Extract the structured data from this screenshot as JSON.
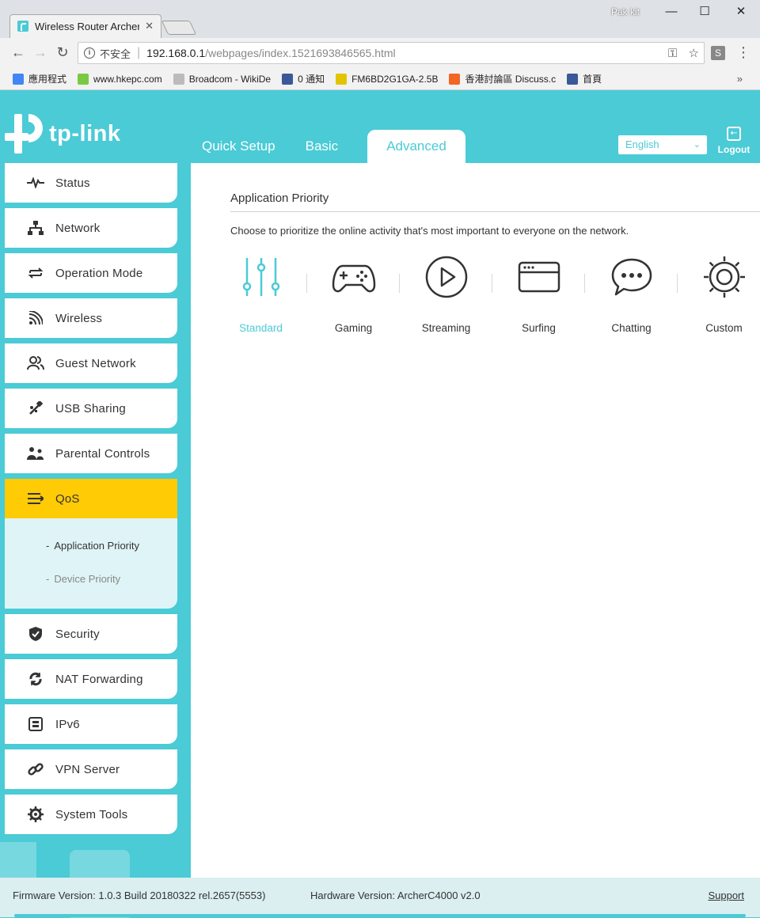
{
  "browser": {
    "tab_title": "Wireless Router Archer C",
    "user": "Pak kit",
    "insecure_label": "不安全",
    "url_host": "192.168.0.1",
    "url_path": "/webpages/index.1521693846565.html",
    "bookmarks": [
      {
        "label": "應用程式",
        "color": "#4285f4"
      },
      {
        "label": "www.hkepc.com",
        "color": "#7ac943"
      },
      {
        "label": "Broadcom - WikiDe",
        "color": "#bbbbbb"
      },
      {
        "label": "0 通知",
        "color": "#3b5998"
      },
      {
        "label": "FM6BD2G1GA-2.5B",
        "color": "#e2c400"
      },
      {
        "label": "香港討論區 Discuss.c",
        "color": "#f26522"
      },
      {
        "label": "首頁",
        "color": "#3b5998"
      }
    ],
    "bookmarks_more": "»"
  },
  "header": {
    "logo_text": "tp-link",
    "tabs": [
      {
        "label": "Quick Setup"
      },
      {
        "label": "Basic"
      },
      {
        "label": "Advanced"
      }
    ],
    "language": "English",
    "logout": "Logout"
  },
  "sidebar": {
    "items": [
      {
        "label": "Status",
        "icon": "pulse-icon"
      },
      {
        "label": "Network",
        "icon": "network-icon"
      },
      {
        "label": "Operation Mode",
        "icon": "swap-icon"
      },
      {
        "label": "Wireless",
        "icon": "wifi-icon"
      },
      {
        "label": "Guest Network",
        "icon": "users-icon"
      },
      {
        "label": "USB Sharing",
        "icon": "usb-icon"
      },
      {
        "label": "Parental Controls",
        "icon": "family-icon"
      },
      {
        "label": "QoS",
        "icon": "qos-icon"
      },
      {
        "label": "Security",
        "icon": "shield-icon"
      },
      {
        "label": "NAT Forwarding",
        "icon": "nat-icon"
      },
      {
        "label": "IPv6",
        "icon": "ipv6-icon"
      },
      {
        "label": "VPN Server",
        "icon": "link-icon"
      },
      {
        "label": "System Tools",
        "icon": "gear-icon"
      }
    ],
    "qos_submenu": [
      {
        "label": "Application Priority"
      },
      {
        "label": "Device Priority"
      }
    ]
  },
  "main": {
    "title": "Application Priority",
    "description": "Choose to prioritize the online activity that's most important to everyone on the network.",
    "apps": [
      {
        "label": "Standard",
        "icon": "sliders-icon"
      },
      {
        "label": "Gaming",
        "icon": "gamepad-icon"
      },
      {
        "label": "Streaming",
        "icon": "play-icon"
      },
      {
        "label": "Surfing",
        "icon": "browser-icon"
      },
      {
        "label": "Chatting",
        "icon": "chat-icon"
      },
      {
        "label": "Custom",
        "icon": "gear-icon"
      }
    ],
    "accent_color": "#4acbd6",
    "active_sidebar_color": "#ffcb05"
  },
  "footer": {
    "firmware": "Firmware Version: 1.0.3 Build 20180322 rel.2657(5553)",
    "hardware": "Hardware Version: ArcherC4000 v2.0",
    "support": "Support"
  }
}
